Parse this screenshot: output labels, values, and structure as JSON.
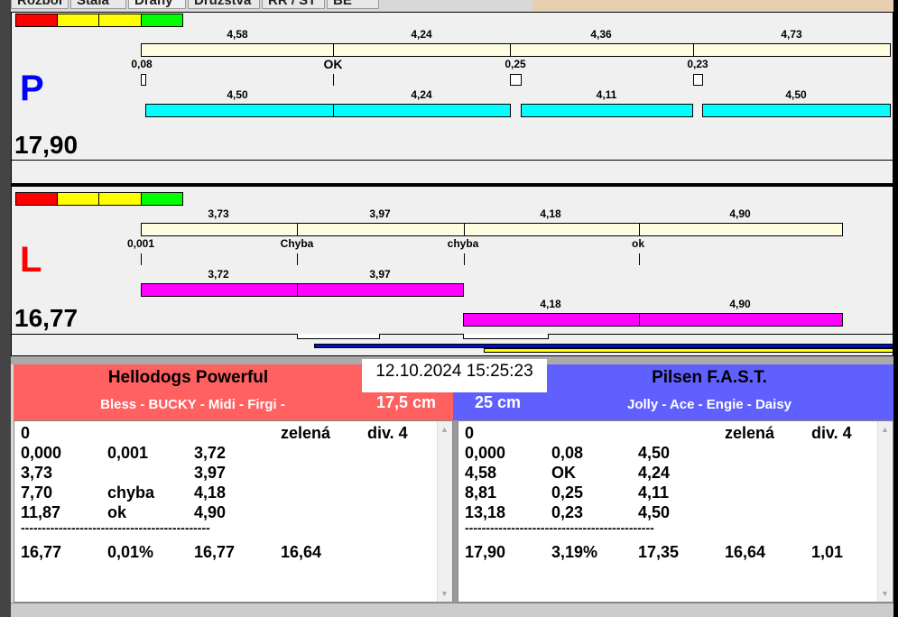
{
  "tabs": [
    "Rozbor",
    "Stála",
    "Dráhy",
    "Družstva",
    "RR / ST",
    "BE"
  ],
  "colors": {
    "red": "#ff0000",
    "yellow": "#ffff00",
    "green": "#00ff00",
    "cream": "#fffde0",
    "cyan": "#00ffff",
    "magenta": "#ff00ff",
    "left_team": "#ff6060",
    "right_team": "#6060ff"
  },
  "lane_p": {
    "letter": "P",
    "total": "17,90",
    "top_times": [
      "4,58",
      "4,24",
      "4,36",
      "4,73"
    ],
    "reactions": [
      "0,08",
      "OK",
      "0,25",
      "0,23"
    ],
    "run_times": [
      "4,50",
      "4,24",
      "4,11",
      "4,50"
    ]
  },
  "lane_l": {
    "letter": "L",
    "total": "16,77",
    "top_times": [
      "3,73",
      "3,97",
      "4,18",
      "4,90"
    ],
    "reactions": [
      "0,001",
      "Chyba",
      "chyba",
      "ok"
    ],
    "run_times_row1": [
      "3,72",
      "3,97"
    ],
    "run_times_row2": [
      "4,18",
      "4,90"
    ]
  },
  "datetime": "12.10.2024 15:25:23",
  "left_team": {
    "name": "Hellodogs Powerful",
    "dogs": "Bless - BUCKY - Midi - Firgi -",
    "jump": "17,5 cm",
    "table": {
      "header": [
        "0",
        "",
        "",
        "zelená",
        "div. 4"
      ],
      "rows": [
        [
          "0,000",
          "0,001",
          "3,72"
        ],
        [
          "3,73",
          "",
          "3,97"
        ],
        [
          "7,70",
          "chyba",
          "4,18"
        ],
        [
          "11,87",
          "ok",
          "4,90"
        ]
      ],
      "separator": "---------------------------------------------",
      "summary": [
        "16,77",
        "0,01%",
        "16,77",
        "16,64",
        ""
      ]
    }
  },
  "right_team": {
    "name": "Pilsen F.A.S.T.",
    "dogs": "Jolly - Ace - Engie - Daisy",
    "jump": "25 cm",
    "table": {
      "header": [
        "0",
        "",
        "",
        "zelená",
        "div. 4"
      ],
      "rows": [
        [
          "0,000",
          "0,08",
          "4,50"
        ],
        [
          "4,58",
          "OK",
          "4,24"
        ],
        [
          "8,81",
          "0,25",
          "4,11"
        ],
        [
          "13,18",
          "0,23",
          "4,50"
        ]
      ],
      "separator": "---------------------------------------------",
      "summary": [
        "17,90",
        "3,19%",
        "17,35",
        "16,64",
        "1,01"
      ]
    }
  }
}
